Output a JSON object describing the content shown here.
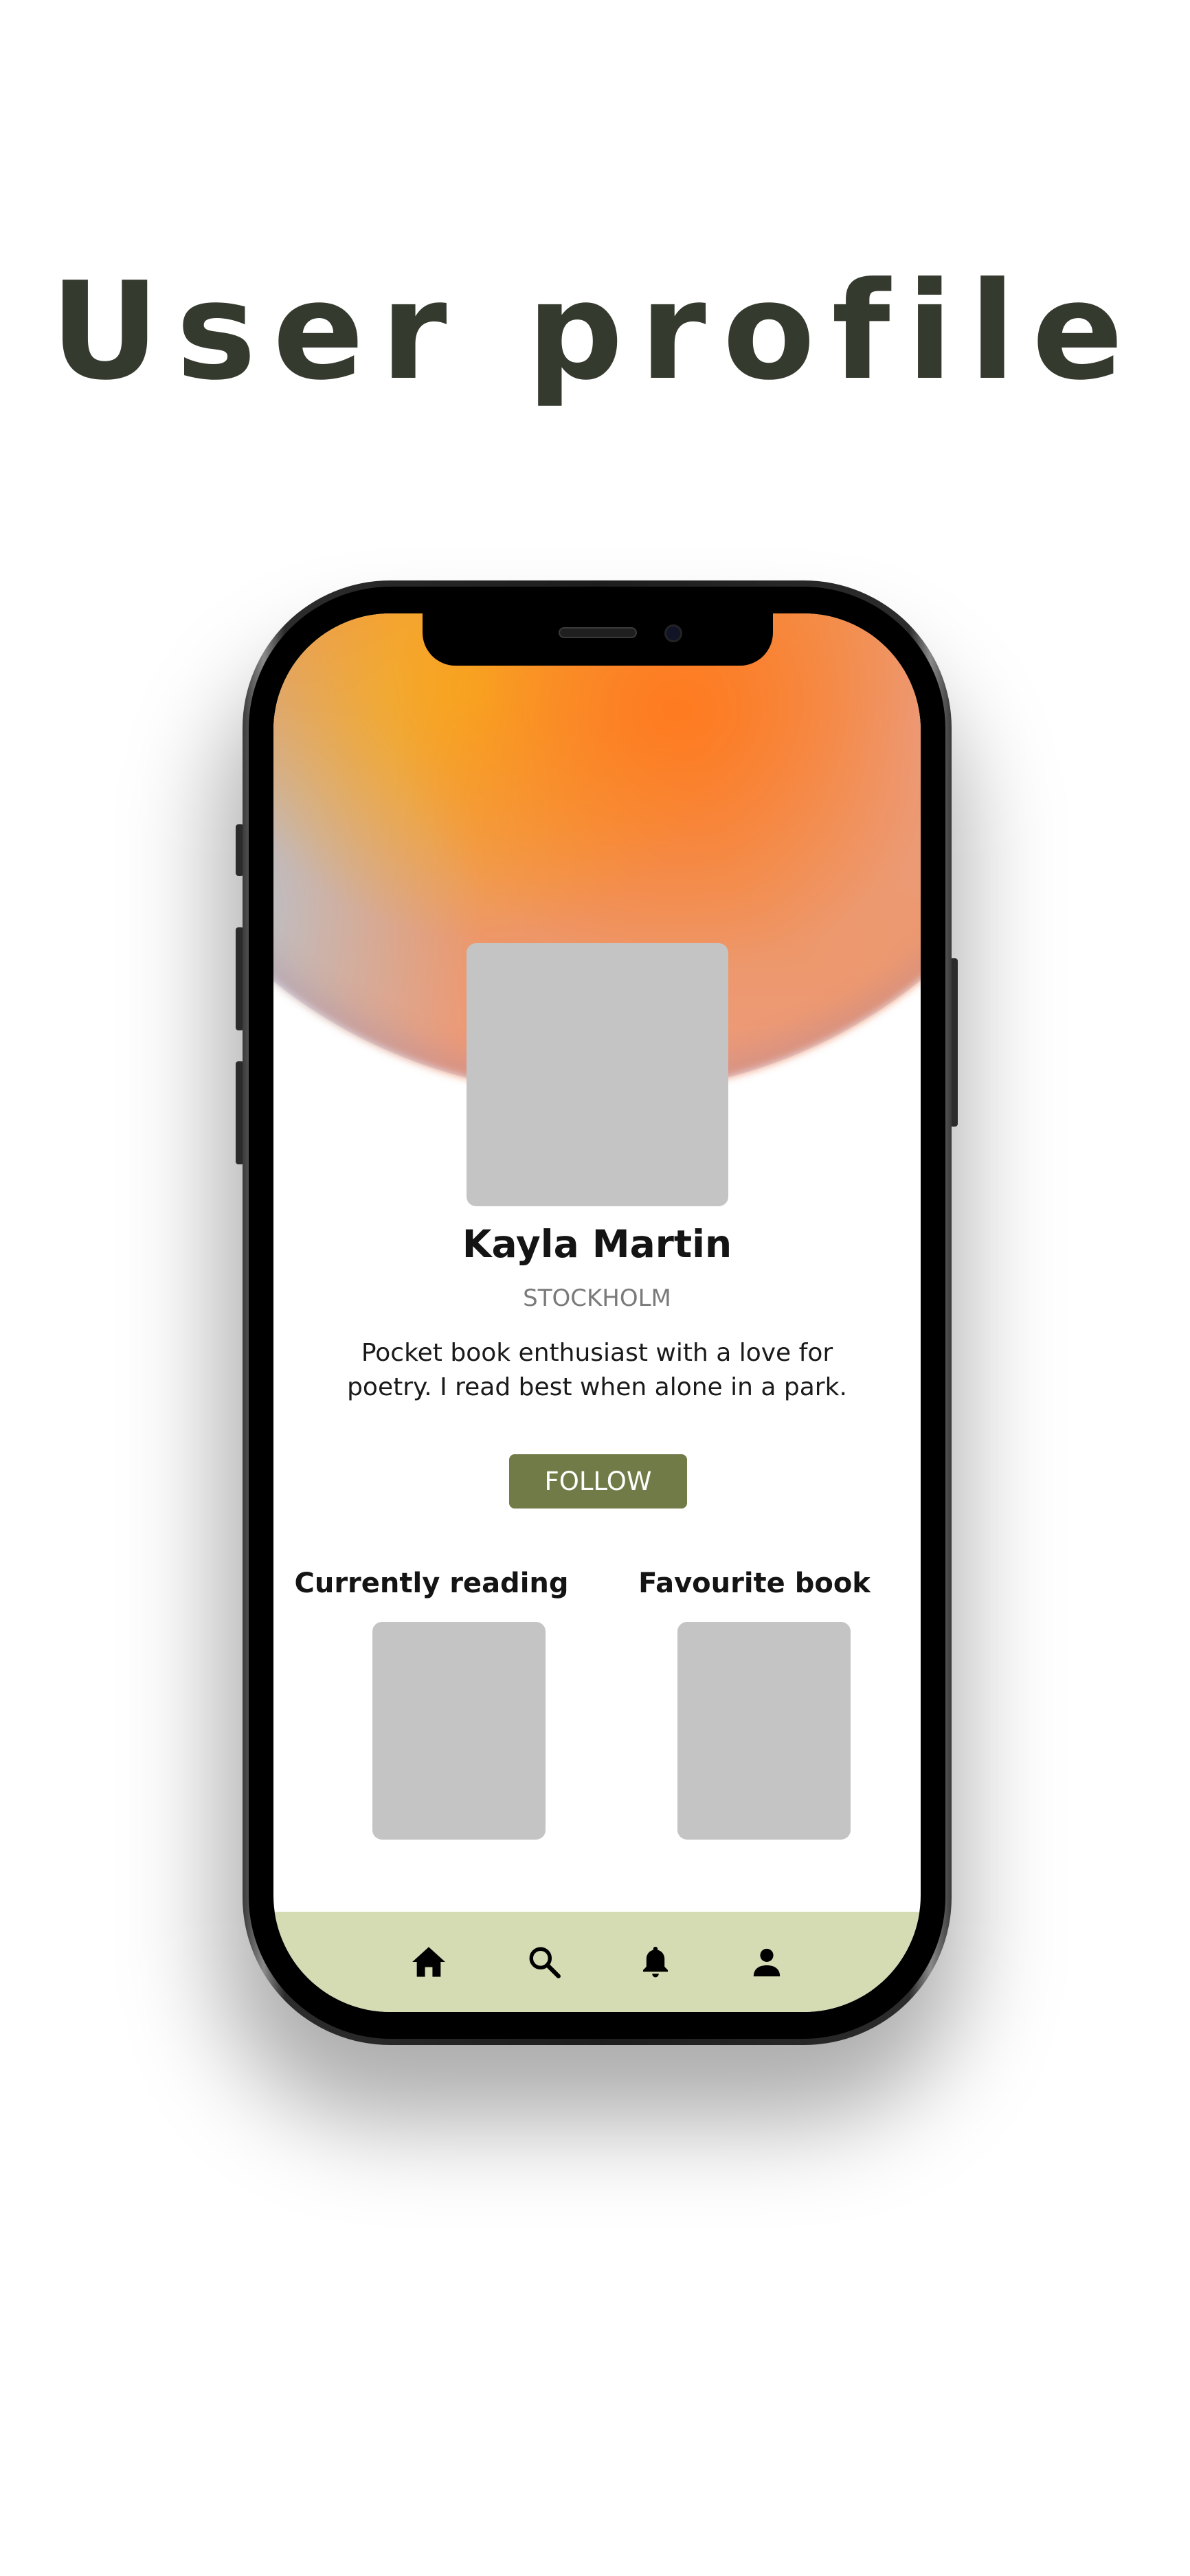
{
  "page": {
    "title": "User profile"
  },
  "profile": {
    "name": "Kayla Martin",
    "location": "STOCKHOLM",
    "bio_line_1": "Pocket book enthusiast with a love for",
    "bio_line_2": "poetry. I read best when alone in a park.",
    "follow_label": "FOLLOW"
  },
  "books": {
    "currently_reading_label": "Currently reading",
    "favourite_label": "Favourite book"
  },
  "nav": {
    "items": [
      {
        "icon": "home-icon"
      },
      {
        "icon": "search-icon"
      },
      {
        "icon": "bell-icon"
      },
      {
        "icon": "profile-icon"
      }
    ]
  },
  "colors": {
    "title": "#343a2e",
    "follow_button": "#717b47",
    "nav_background": "#d5dcb4",
    "placeholder": "#c4c4c4"
  }
}
